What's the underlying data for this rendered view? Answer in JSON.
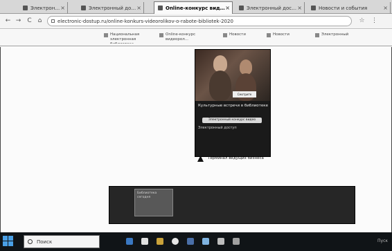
{
  "browser": {
    "tabs": [
      {
        "label": "Электронн...",
        "active": false
      },
      {
        "label": "Электронный доступ",
        "active": false
      },
      {
        "label": "Online-конкурс видеорол",
        "active": true
      },
      {
        "label": "Электронный доступ",
        "active": false
      },
      {
        "label": "Новости и события",
        "active": false
      }
    ],
    "address": "electronic-dostup.ru/online-konkurs-videorolikov-o-rabote-bibliotek-2020",
    "bookmarks": [
      {
        "label": "Национальная электронная библиотека"
      },
      {
        "label": "Online-конкурс видеорол..."
      },
      {
        "label": "Новости"
      },
      {
        "label": "Новости"
      },
      {
        "label": "Электронный"
      }
    ],
    "nav": {
      "back": "←",
      "forward": "→",
      "reload": "C",
      "home": "⌂",
      "star": "☆",
      "menu": "⋮"
    }
  },
  "page": {
    "poster": {
      "title": "Культурные встречи в библиотеке",
      "promo": "Смотрите",
      "pill": "Электронный конкурс видео",
      "subtitle": "Электронный доступ"
    },
    "poster_footer": "Терминал ведущих бизнеса",
    "video_thumb_text": "Библиотека сегодня"
  },
  "taskbar": {
    "search_placeholder": "Поиск",
    "tray": "Пуск"
  },
  "colors": {
    "accent": "#4aa0e6",
    "taskbar": "#101417"
  }
}
